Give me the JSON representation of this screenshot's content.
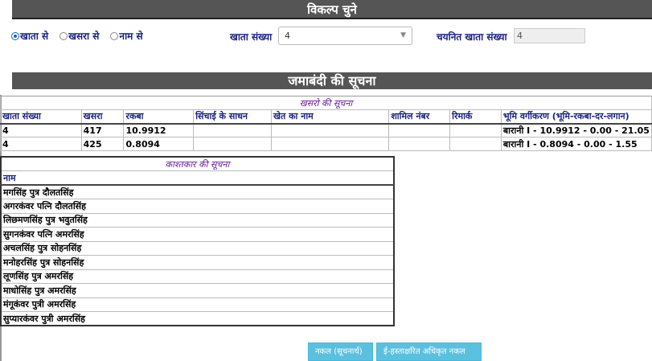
{
  "header1": "विकल्प चुने",
  "radios": [
    {
      "label": "खाता से",
      "checked": true
    },
    {
      "label": "खसरा से",
      "checked": false
    },
    {
      "label": "नाम से",
      "checked": false
    }
  ],
  "khata_label": "खाता संख्या",
  "khata_value": "4",
  "selected_label": "चयनित खाता संख्या",
  "selected_value": "4",
  "header2": "जमाबंदी की सूचना",
  "khasra_table": {
    "caption": "खसरो की सूचना",
    "headers": [
      "खाता संख्या",
      "खसरा",
      "रकबा",
      "सिंचाई के साधन",
      "खेत का नाम",
      "शामिल नंबर",
      "रिमार्क",
      "भूमि वर्गीकरण (भूमि-रकबा-दर-लगान)"
    ],
    "rows": [
      [
        "4",
        "417",
        "10.9912",
        "",
        "",
        "",
        "",
        "बारानी I - 10.9912 - 0.00 - 21.05"
      ],
      [
        "4",
        "425",
        "0.8094",
        "",
        "",
        "",
        "",
        "बारानी I - 0.8094 - 0.00 - 1.55"
      ]
    ]
  },
  "owner_table": {
    "caption": "काश्तकार की सूचना",
    "header": "नाम",
    "rows": [
      "मगसिंह पुत्र दौलतसिंह",
      "अगरकंवर पत्नि दौलतसिंह",
      "लिछमणसिंह पुत्र भवुतसिंह",
      "सुगनकंवर पत्नि अमरसिंह",
      "अचलसिंह पुत्र सोहनसिंह",
      "मनोहरसिंह पुत्र सोहनसिंह",
      "लूणसिंह पुत्र अमरसिंह",
      "माधोसिंह पुत्र अमरसिंह",
      "मंगूकंवर पुत्री अमरसिंह",
      "सुप्यारकंवर पुत्री अमरसिंह"
    ]
  },
  "buttons": {
    "copy_info": "नकल (सूचनार्थ)",
    "esigned_copy": "ई-हस्ताक्षरित अधिकृत नकल"
  },
  "icons": {
    "select_arrow": "chevron-down-icon"
  }
}
